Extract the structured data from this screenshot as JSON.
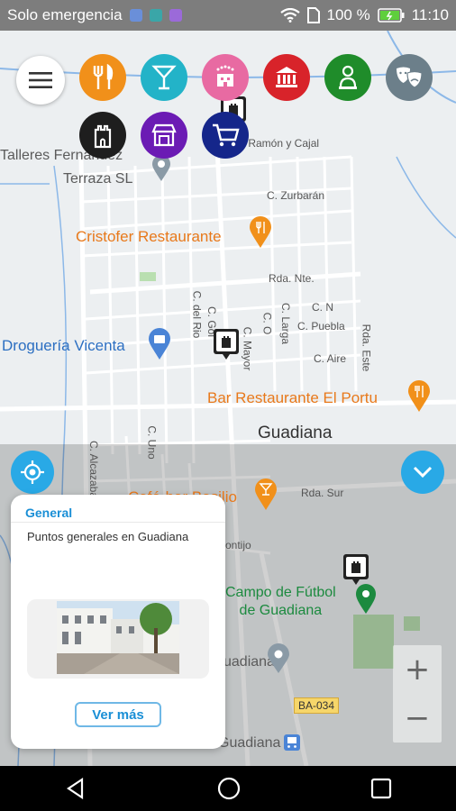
{
  "status": {
    "carrier": "Solo emergencia",
    "battery": "100 %",
    "time": "11:10"
  },
  "categories": [
    {
      "name": "restaurants",
      "color": "#f1901a",
      "icon": "fork-knife-icon"
    },
    {
      "name": "bars",
      "color": "#23b3c8",
      "icon": "cocktail-icon"
    },
    {
      "name": "hotels",
      "color": "#e86aa2",
      "icon": "hotel-stars-icon"
    },
    {
      "name": "monuments",
      "color": "#d8232a",
      "icon": "museum-icon"
    },
    {
      "name": "services",
      "color": "#1f8c2a",
      "icon": "person-icon"
    },
    {
      "name": "culture",
      "color": "#6c7f8a",
      "icon": "theater-masks-icon"
    },
    {
      "name": "heritage",
      "color": "#1e1e1e",
      "icon": "tower-icon"
    },
    {
      "name": "shops",
      "color": "#6b1bb4",
      "icon": "shop-icon"
    },
    {
      "name": "shopping",
      "color": "#15268a",
      "icon": "cart-icon"
    }
  ],
  "map": {
    "streets": {
      "ramon": "C. Ramón y Cajal",
      "zurbaran": "C. Zurbarán",
      "rda_nte": "Rda. Nte.",
      "c_n": "C. N",
      "c_puebla": "C. Puebla",
      "c_aire": "C. Aire",
      "rda_este": "Rda. Este",
      "c_rio": "C. del Rio",
      "c_gol": "C. Gol",
      "c_mayor": "C. Mayor",
      "c_o": "C. O",
      "c_larga": "C. Larga",
      "c_uno": "C. Uno",
      "c_alcazaba": "C. Alcazaba",
      "rda_sur": "Rda. Sur",
      "montijo": "ontijo",
      "ba034": "BA-034"
    },
    "places": {
      "talleres": "Talleres Fernández",
      "terraza": "Terraza SL",
      "cristofer": "Cristofer Restaurante",
      "drogueria": "Droguería Vicenta",
      "bar_portu": "Bar Restaurante El Portu",
      "town": "Guadiana",
      "cafe_basilio": "Café-bar Basilio",
      "campo1": "Campo de Fútbol",
      "campo2": "de Guadiana",
      "guadiana_bottom": "uadiana",
      "guadiana_bottom2": "Guadiana"
    }
  },
  "card": {
    "title": "General",
    "description": "Puntos generales en Guadiana",
    "button": "Ver más"
  },
  "zoom": {
    "plus": "+",
    "minus": "−"
  }
}
